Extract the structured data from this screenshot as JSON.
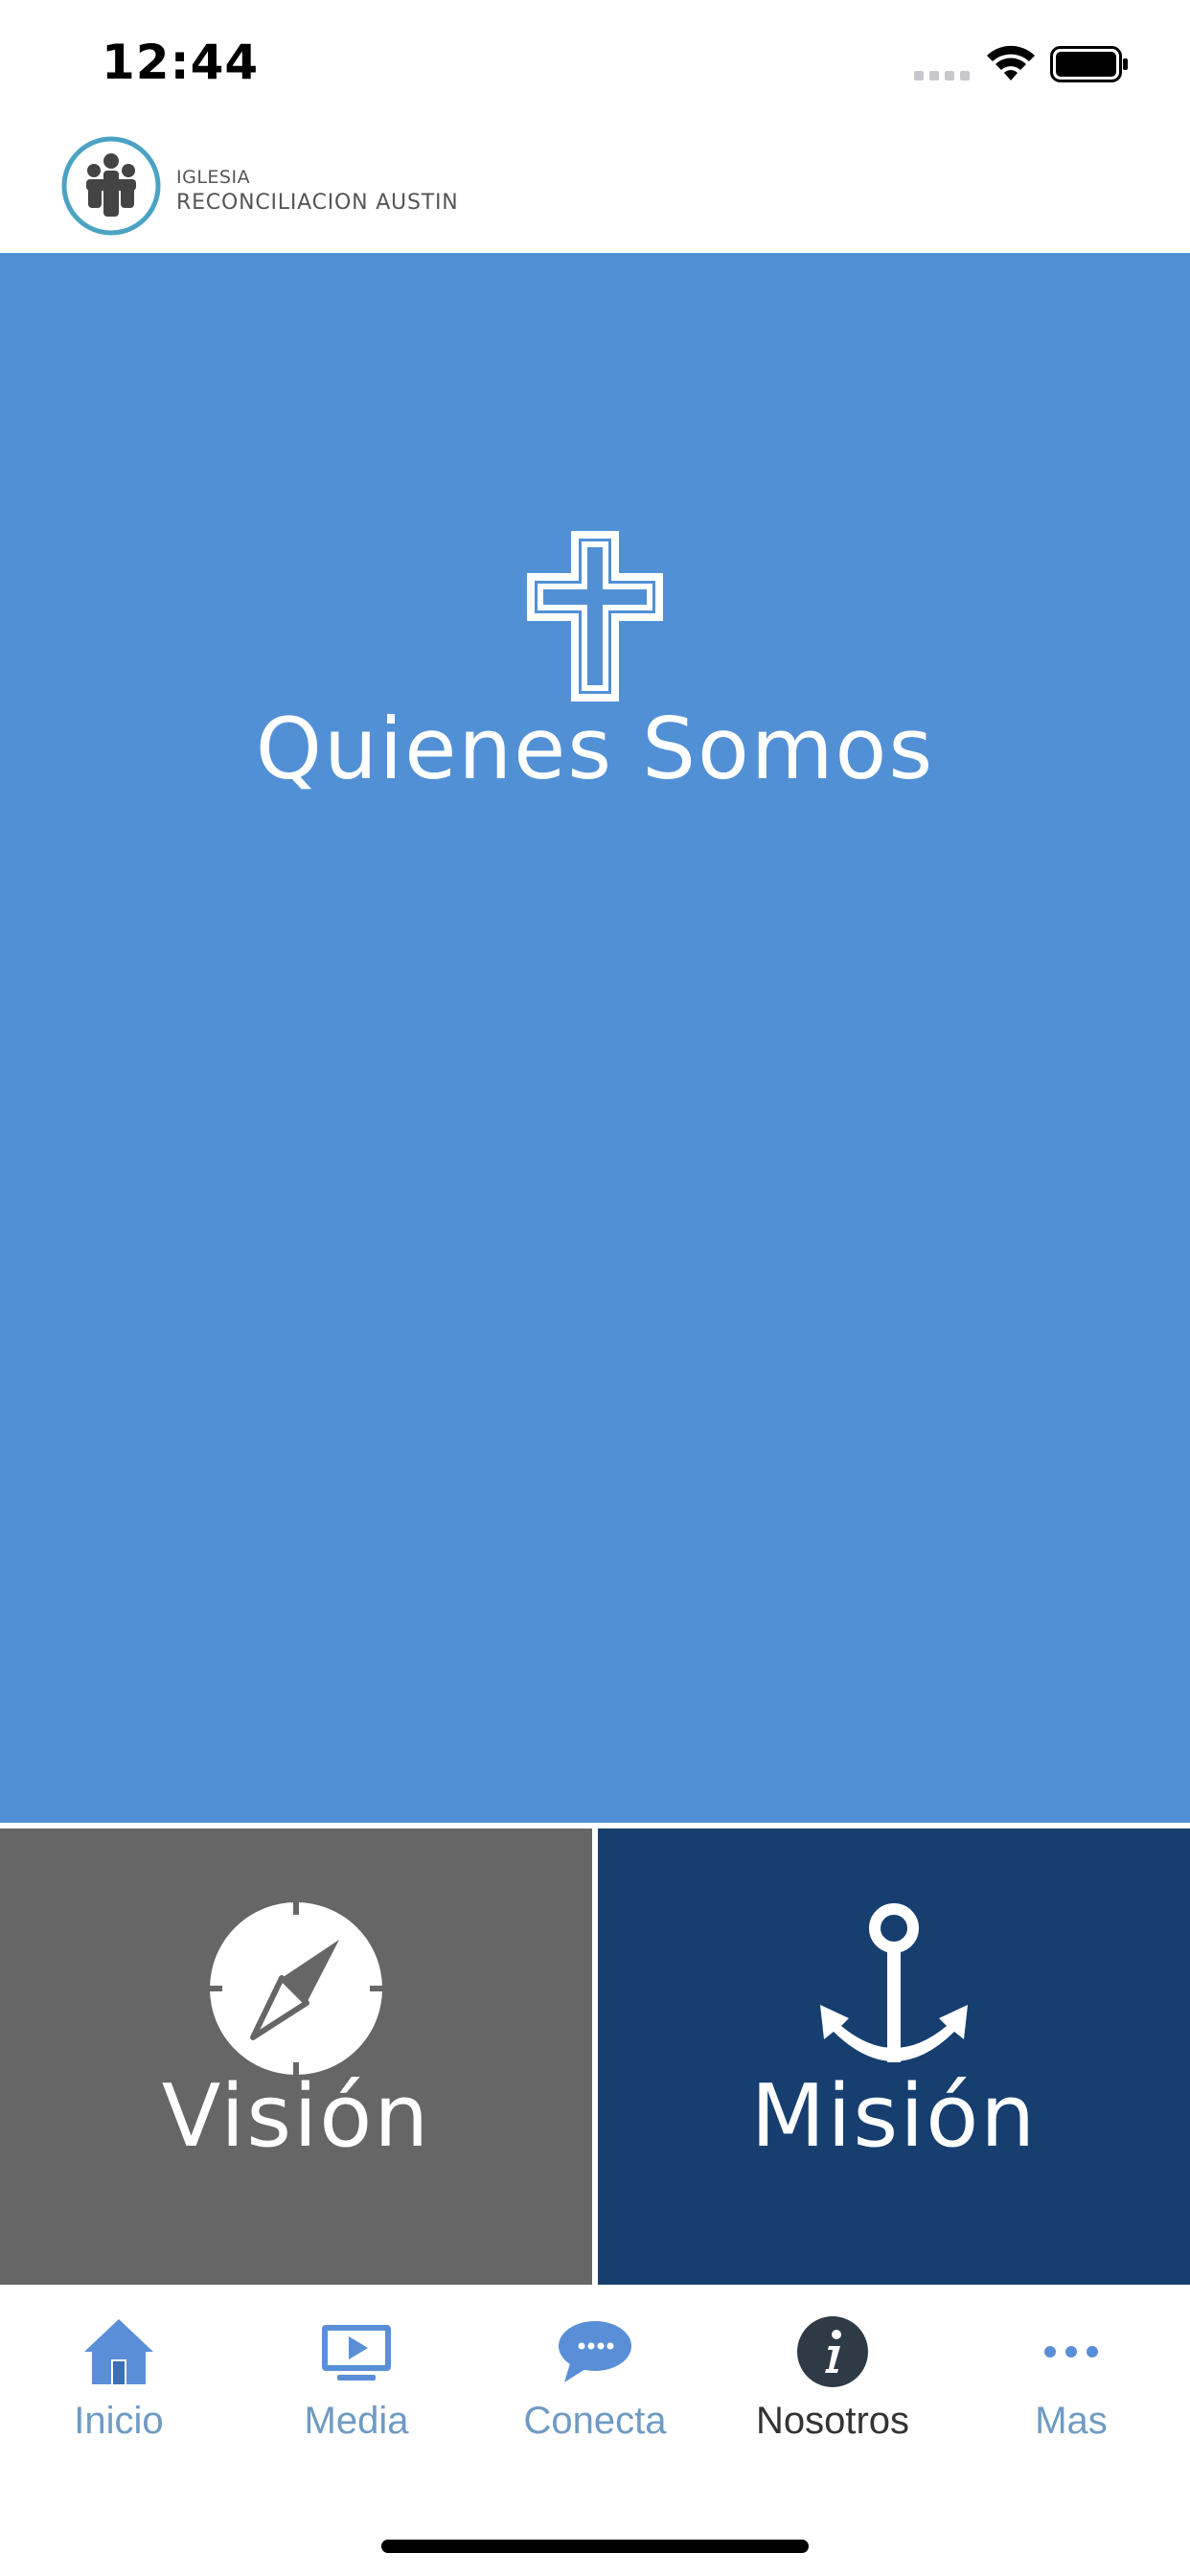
{
  "status_bar": {
    "time": "12:44"
  },
  "header": {
    "logo_line1": "IGLESIA",
    "logo_line2": "RECONCILIACION AUSTIN",
    "logo_icon": "church-people-logo"
  },
  "hero": {
    "title": "Quienes Somos",
    "icon": "cross-icon",
    "color": "#5290d6"
  },
  "tiles": [
    {
      "label": "Visión",
      "icon": "compass-icon",
      "color": "#666666"
    },
    {
      "label": "Misión",
      "icon": "anchor-icon",
      "color": "#163f70"
    }
  ],
  "tab_bar": {
    "active_color": "#333333",
    "inactive_color": "#6e9ac4",
    "tabs": [
      {
        "label": "Inicio",
        "icon": "home-icon",
        "active": false
      },
      {
        "label": "Media",
        "icon": "tv-play-icon",
        "active": false
      },
      {
        "label": "Conecta",
        "icon": "chat-bubble-icon",
        "active": false
      },
      {
        "label": "Nosotros",
        "icon": "info-icon",
        "active": true
      },
      {
        "label": "Mas",
        "icon": "more-dots-icon",
        "active": false
      }
    ]
  }
}
